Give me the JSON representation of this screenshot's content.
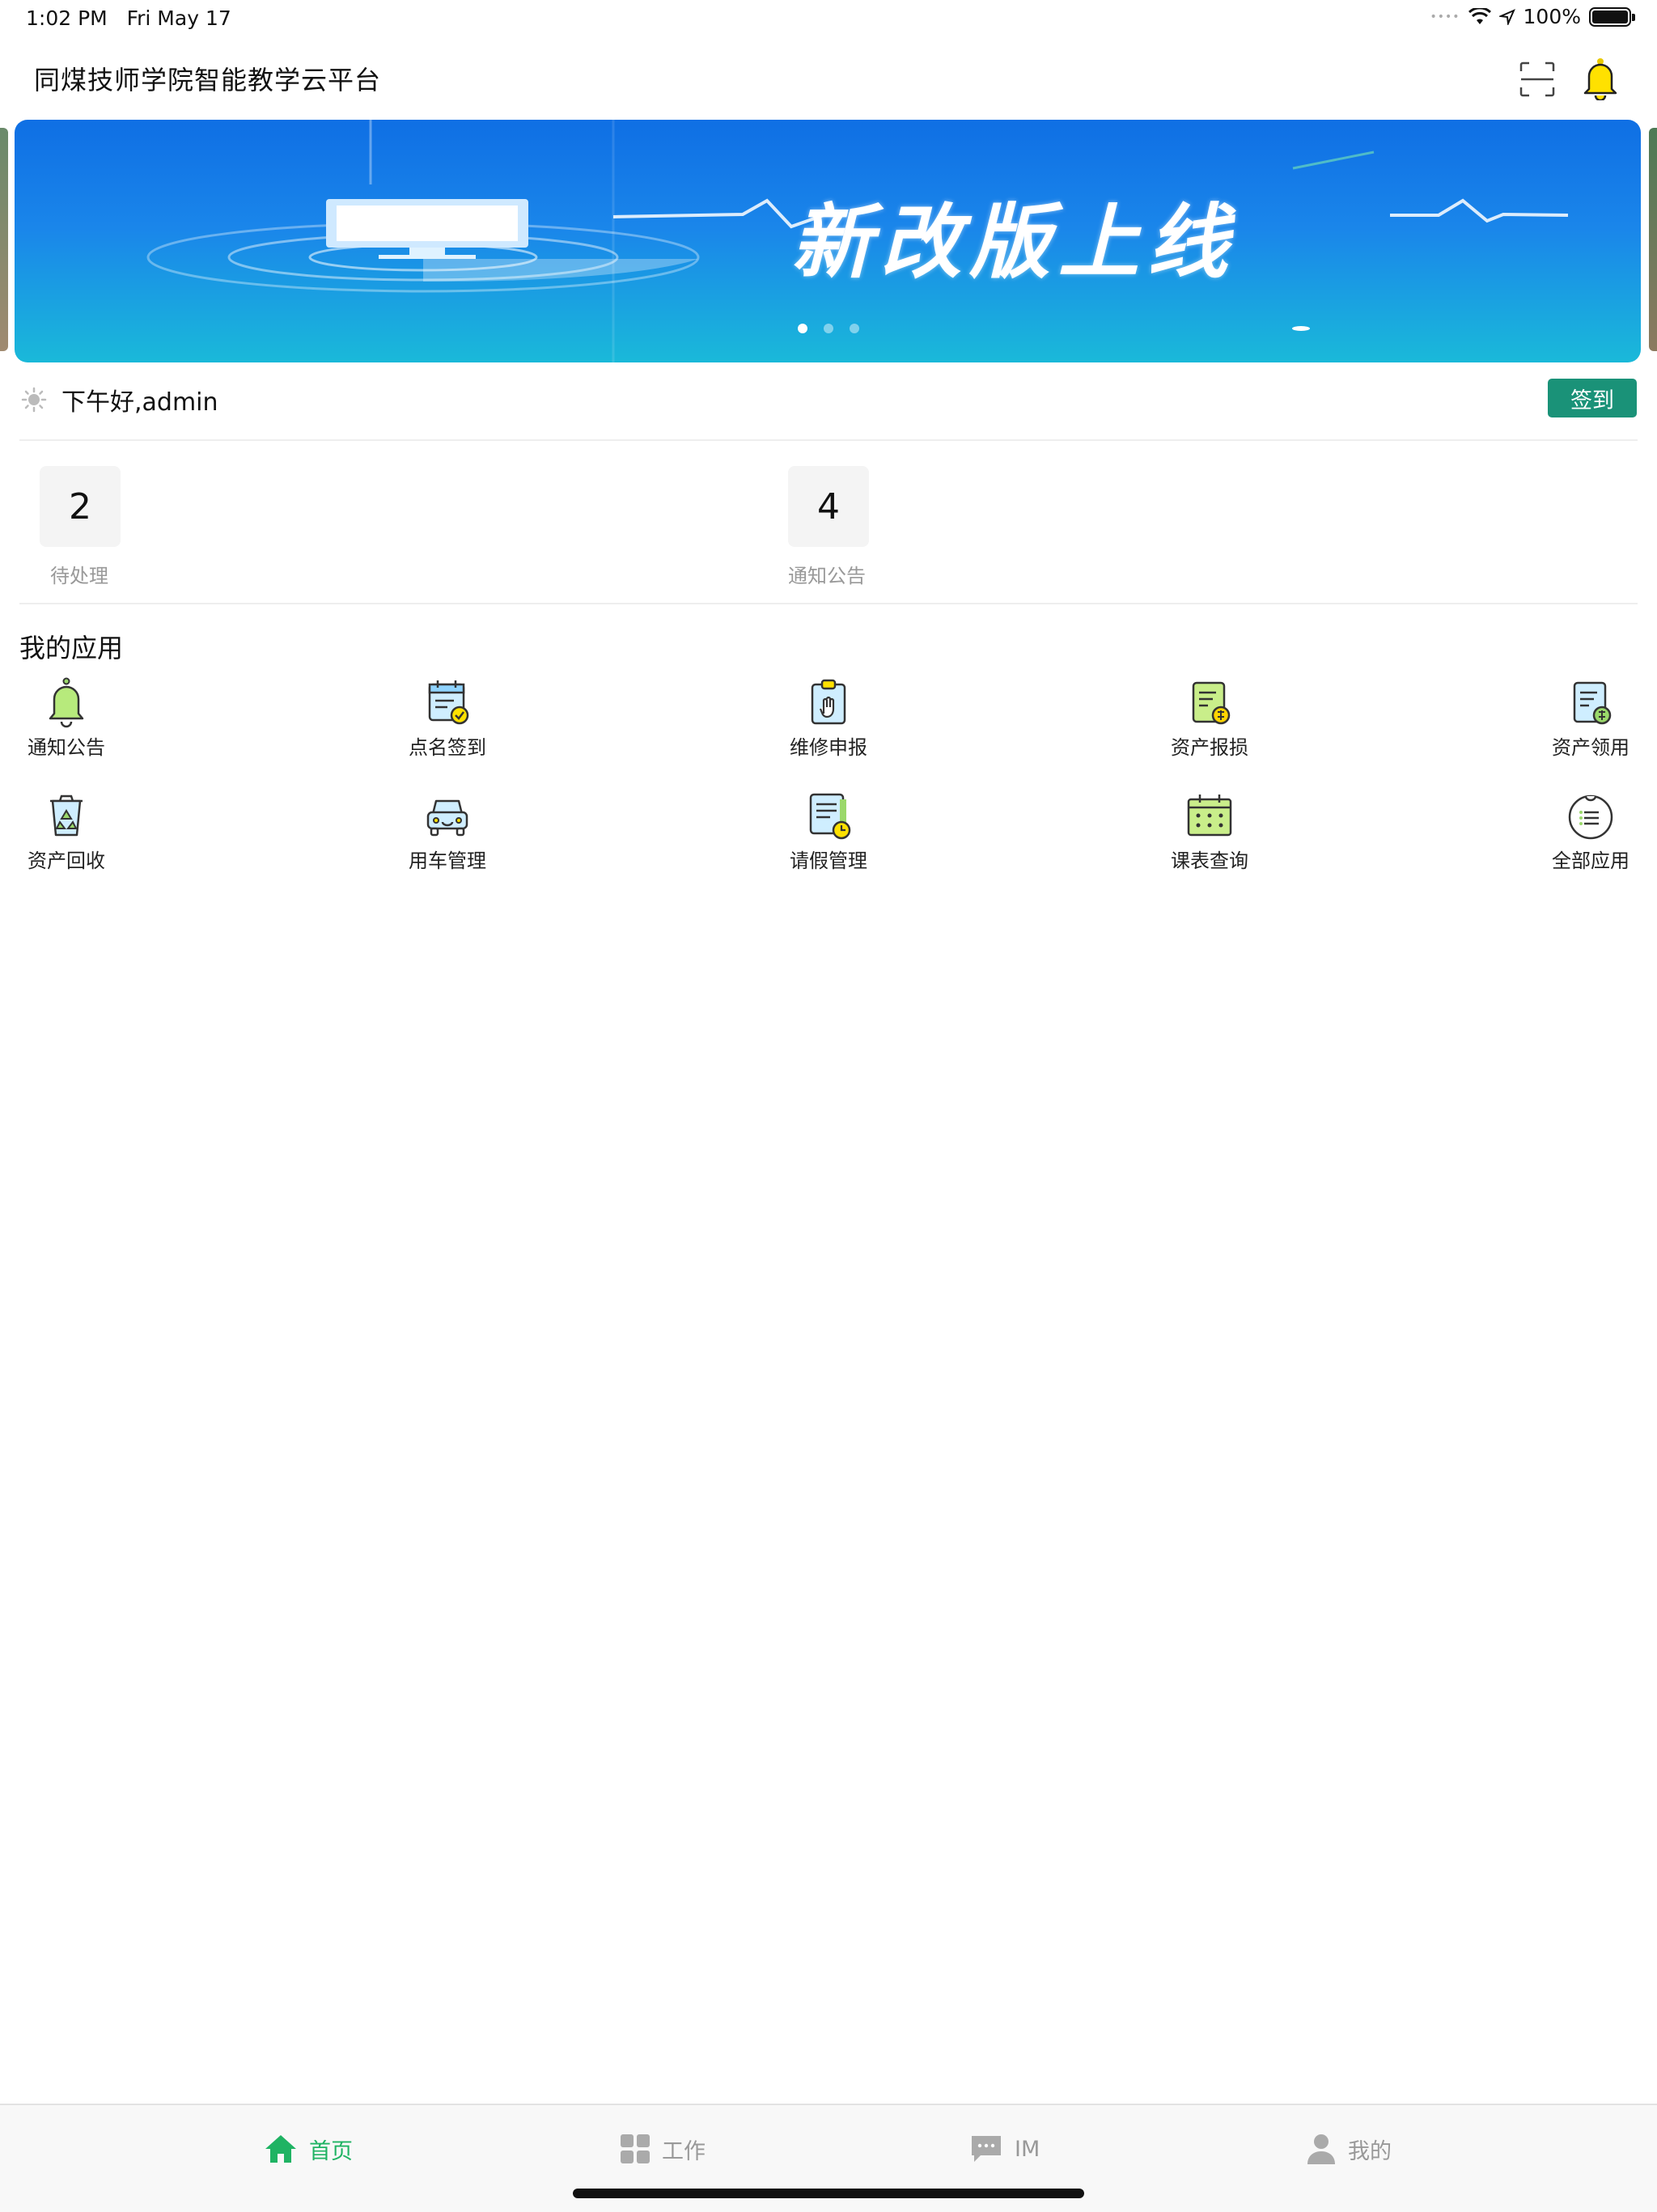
{
  "status_bar": {
    "time": "1:02 PM",
    "date": "Fri May 17",
    "battery": "100%"
  },
  "header": {
    "title": "同煤技师学院智能教学云平台"
  },
  "banner": {
    "text": "新改版上线",
    "page_count": 3,
    "active_page": 1
  },
  "greeting": {
    "text": "下午好,admin",
    "checkin_label": "签到"
  },
  "stats": [
    {
      "value": "2",
      "label": "待处理"
    },
    {
      "value": "4",
      "label": "通知公告"
    }
  ],
  "apps_section": {
    "title": "我的应用",
    "items": [
      {
        "label": "通知公告",
        "icon": "bell-icon"
      },
      {
        "label": "点名签到",
        "icon": "calendar-check-icon"
      },
      {
        "label": "维修申报",
        "icon": "clipboard-hand-icon"
      },
      {
        "label": "资产报损",
        "icon": "document-damage-icon"
      },
      {
        "label": "资产领用",
        "icon": "document-receive-icon"
      },
      {
        "label": "资产回收",
        "icon": "recycle-bin-icon"
      },
      {
        "label": "用车管理",
        "icon": "car-icon"
      },
      {
        "label": "请假管理",
        "icon": "leave-document-icon"
      },
      {
        "label": "课表查询",
        "icon": "timetable-icon"
      },
      {
        "label": "全部应用",
        "icon": "all-apps-icon"
      }
    ]
  },
  "tabbar": [
    {
      "label": "首页",
      "icon": "home-icon",
      "active": true
    },
    {
      "label": "工作",
      "icon": "grid-icon",
      "active": false
    },
    {
      "label": "IM",
      "icon": "chat-icon",
      "active": false
    },
    {
      "label": "我的",
      "icon": "user-icon",
      "active": false
    }
  ],
  "colors": {
    "accent": "#1fb363",
    "checkin": "#1a9278",
    "banner_top": "#0f6fe4",
    "banner_bottom": "#1ab9d9"
  }
}
